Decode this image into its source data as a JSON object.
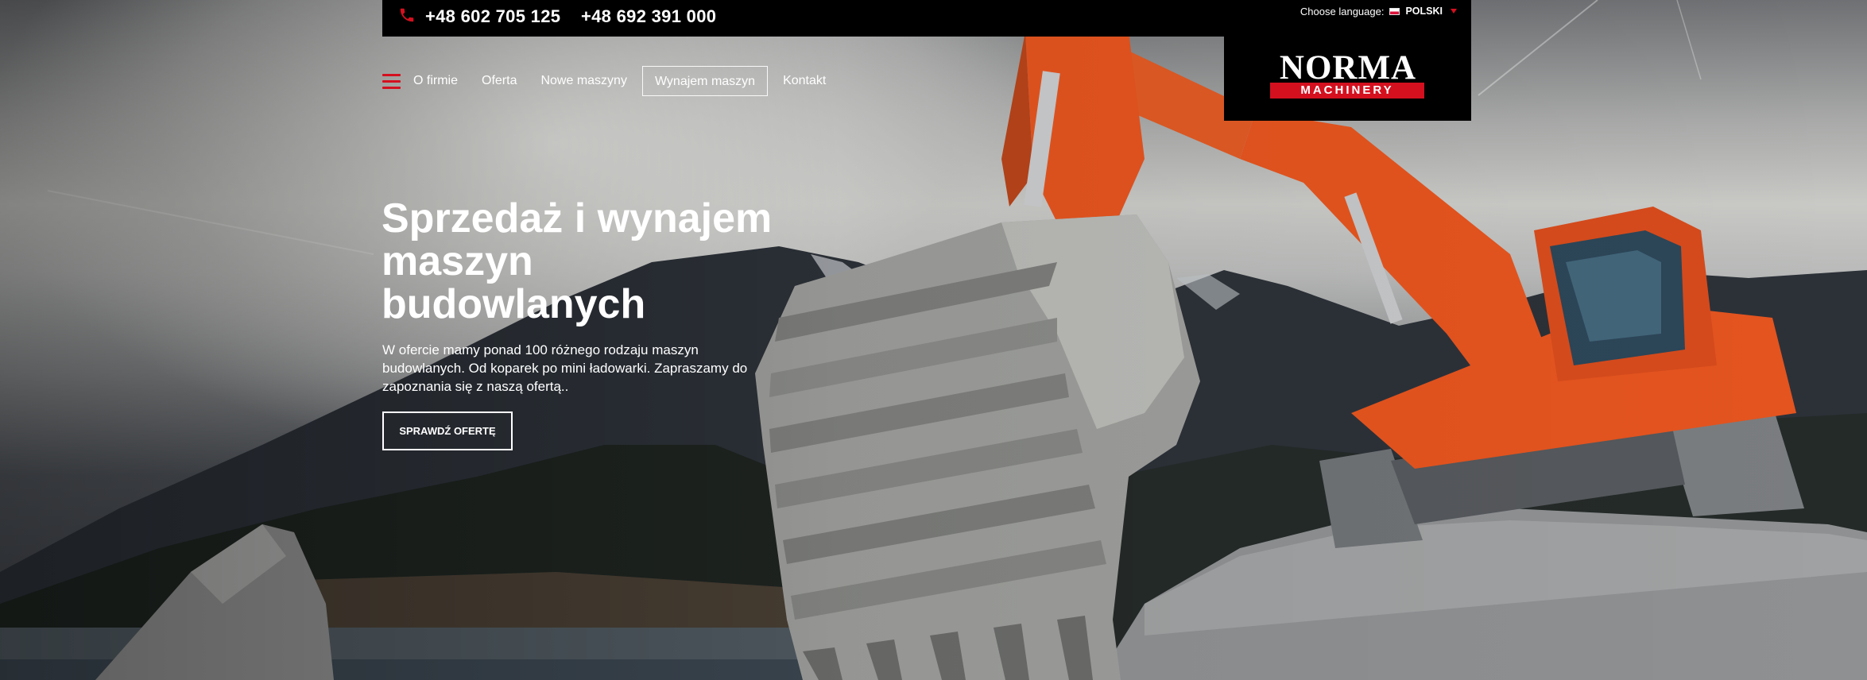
{
  "topbar": {
    "phone_1": "+48 602 705 125",
    "phone_2": "+48 692 391 000",
    "language_label": "Choose language:",
    "language_current": "POLSKI",
    "phone_icon": "phone-icon",
    "flag_icon": "poland-flag-icon"
  },
  "logo": {
    "main": "NORMA",
    "sub": "MACHINERY"
  },
  "nav": {
    "menu_icon": "hamburger-icon",
    "items": [
      {
        "label": "O firmie"
      },
      {
        "label": "Oferta"
      },
      {
        "label": "Nowe maszyny"
      },
      {
        "label": "Wynajem maszyn",
        "active": true
      },
      {
        "label": "Kontakt"
      }
    ]
  },
  "hero": {
    "title": "Sprzedaż i wynajem maszyn budowlanych",
    "description": "W ofercie mamy ponad 100 różnego rodzaju maszyn budowlanych. Od koparek po mini ładowarki. Zapraszamy do zapoznania się z naszą ofertą..",
    "cta_label": "SPRAWDŹ OFERTĘ"
  },
  "colors": {
    "accent": "#d4101f",
    "topbar_bg": "#000000",
    "excavator": "#e4541f",
    "text": "#ffffff"
  }
}
